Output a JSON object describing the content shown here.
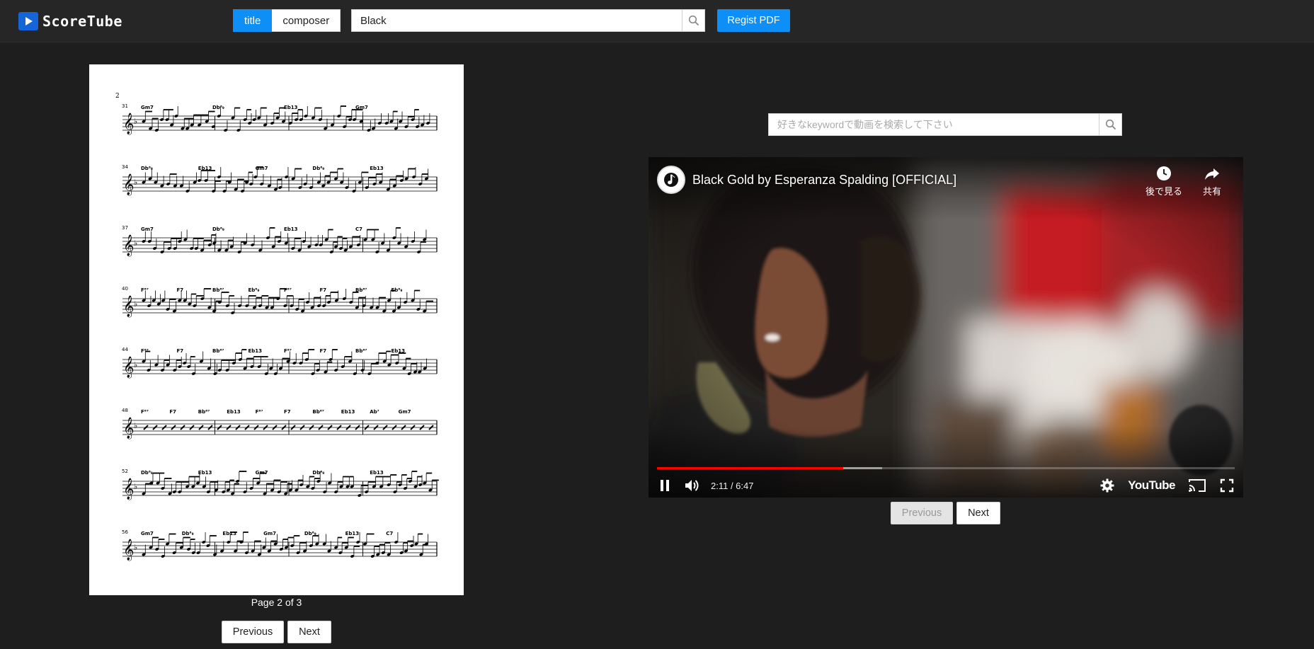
{
  "app": {
    "name": "ScoreTube"
  },
  "header": {
    "mode_tabs": [
      {
        "label": "title",
        "active": true
      },
      {
        "label": "composer",
        "active": false
      }
    ],
    "search": {
      "value": "Black"
    },
    "regist_label": "Regist PDF"
  },
  "score": {
    "page_label": "Page 2 of 3",
    "previous_label": "Previous",
    "next_label": "Next",
    "sheet": {
      "page_number": "2",
      "systems": [
        {
          "measure": "31",
          "chords": [
            "Gm7",
            "Db⁶₉",
            "Eb13",
            "Gm7"
          ]
        },
        {
          "measure": "34",
          "chords": [
            "Db⁶₉",
            "Eb13",
            "Gm7",
            "Db⁶₉",
            "Eb13"
          ]
        },
        {
          "measure": "37",
          "chords": [
            "Gm7",
            "Db⁶₉",
            "Eb13",
            "C7"
          ]
        },
        {
          "measure": "40",
          "chords": [
            "F⁶⁷",
            "F7",
            "Bb⁶⁷",
            "Eb⁶₉",
            "F⁶⁷",
            "F7",
            "Bb⁶⁷",
            "Eb⁶₉"
          ]
        },
        {
          "measure": "44",
          "chords": [
            "F⁶⁷",
            "F7",
            "Bb⁶⁷",
            "Eb13",
            "F⁶⁷",
            "F7",
            "Bb⁶⁷",
            "Eb13"
          ]
        },
        {
          "measure": "48",
          "chords": [
            "F⁶⁷",
            "F7",
            "Bb⁶⁷",
            "Eb13",
            "F⁶⁷",
            "F7",
            "Bb⁶⁷",
            "Eb13",
            "Ab⁷",
            "Gm7"
          ]
        },
        {
          "measure": "52",
          "chords": [
            "Db⁶₉",
            "Eb13",
            "Gm7",
            "Db⁶₉",
            "Eb13"
          ]
        },
        {
          "measure": "56",
          "chords": [
            "Gm7",
            "Db⁶₉",
            "Eb13",
            "Gm7",
            "Db⁶₉",
            "Eb13",
            "C7"
          ]
        }
      ]
    }
  },
  "video_panel": {
    "search_placeholder": "好きなkeywordで動画を検索して下さい",
    "previous_label": "Previous",
    "next_label": "Next",
    "player": {
      "title": "Black Gold by Esperanza Spalding [OFFICIAL]",
      "watch_later_label": "後で見る",
      "share_label": "共有",
      "time": "2:11 / 6:47",
      "progress_fraction": 0.322,
      "buffer_fraction": 0.39,
      "brand": "YouTube",
      "progress_color": "#ff0000"
    }
  },
  "icons": [
    "play-logo-icon",
    "search-icon",
    "clock-icon",
    "share-icon",
    "pause-icon",
    "volume-icon",
    "gear-icon",
    "cast-icon",
    "fullscreen-icon",
    "channel-note-icon"
  ],
  "colors": {
    "accent": "#0d8ff7",
    "background": "#1e1e1e",
    "header": "#262626"
  }
}
